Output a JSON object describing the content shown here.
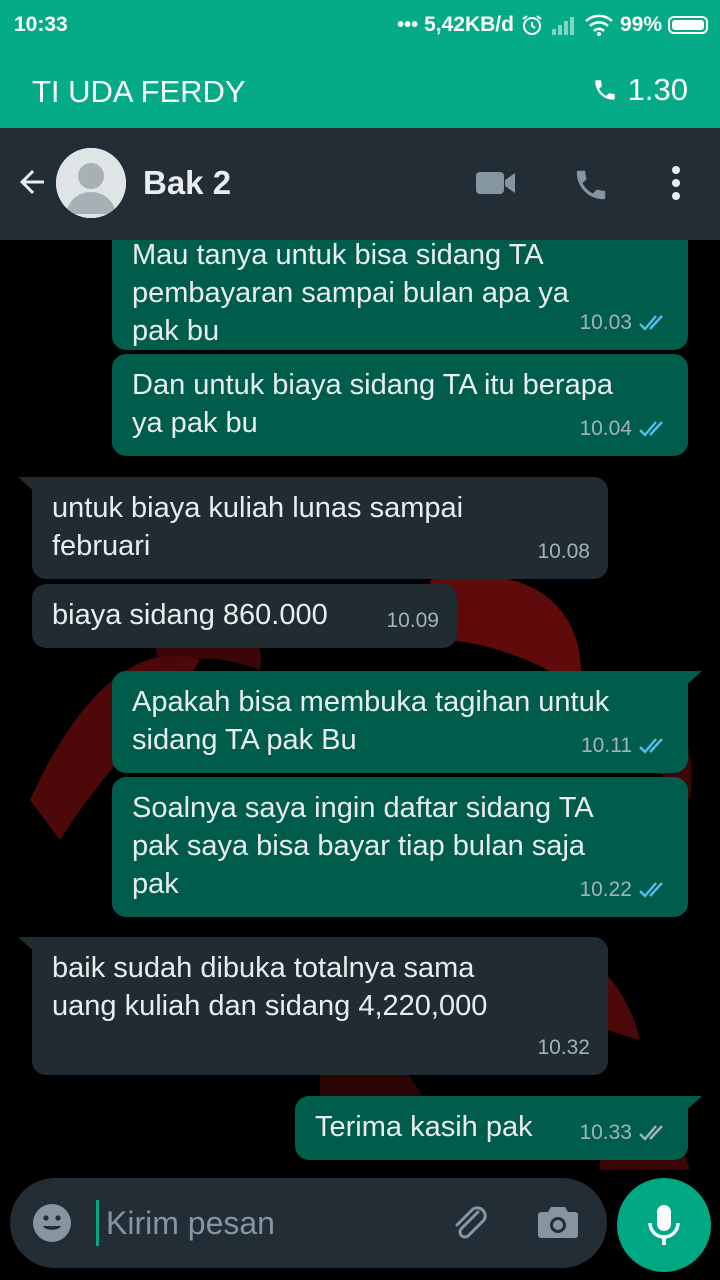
{
  "status_bar": {
    "time": "10:33",
    "dots": "•••",
    "net_speed": "5,42KB/d",
    "battery": "99%",
    "battery_level": 0.99
  },
  "call_banner": {
    "name": "TI UDA FERDY",
    "duration": "1.30"
  },
  "header": {
    "contact_name": "Bak 2"
  },
  "messages": [
    {
      "dir": "out",
      "text_1": "Mau tanya untuk bisa sidang TA",
      "text_2": "pembayaran sampai bulan apa ya",
      "text_3": "pak bu",
      "time": "10.03"
    },
    {
      "dir": "out",
      "text_1": "Dan untuk biaya sidang TA itu berapa",
      "text_2": "ya pak bu",
      "time": "10.04"
    },
    {
      "dir": "in",
      "text_1": "untuk biaya kuliah lunas sampai",
      "text_2": "februari",
      "time": "10.08"
    },
    {
      "dir": "in",
      "text_1": "biaya sidang 860.000",
      "time": "10.09"
    },
    {
      "dir": "out",
      "text_1": "Apakah bisa membuka tagihan untuk",
      "text_2": "sidang TA pak Bu",
      "time": "10.11"
    },
    {
      "dir": "out",
      "text_1": "Soalnya saya ingin daftar sidang TA",
      "text_2": "pak saya bisa bayar tiap bulan saja",
      "text_3": "pak",
      "time": "10.22"
    },
    {
      "dir": "in",
      "text_1": "baik sudah dibuka totalnya sama",
      "text_2": "uang kuliah dan sidang 4,220,000",
      "time": "10.32"
    },
    {
      "dir": "out",
      "text_1": "Terima kasih pak",
      "time": "10.33",
      "read": false
    }
  ],
  "composer": {
    "placeholder": "Kirim pesan"
  },
  "colors": {
    "accent": "#00a884",
    "status_bar": "#05ab86",
    "header": "#232d36",
    "outgoing_bubble": "#005d4b",
    "incoming_bubble": "#212b32",
    "read_ticks": "#53bdeb"
  }
}
